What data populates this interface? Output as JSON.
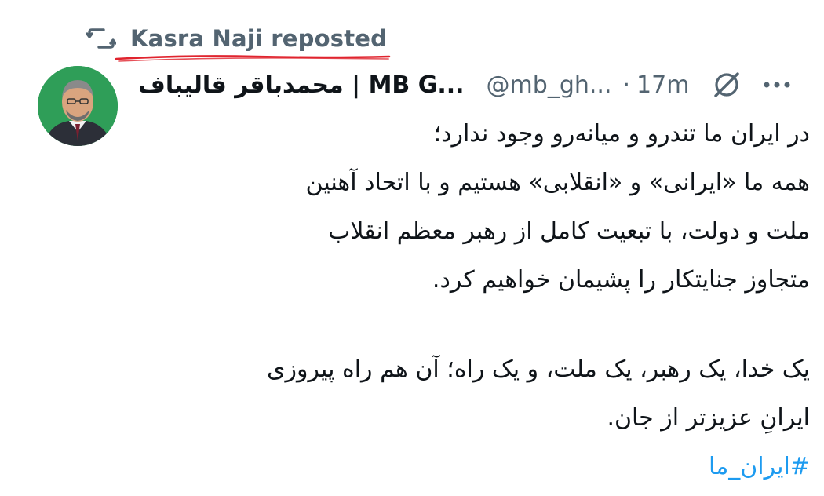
{
  "repost": {
    "label": "Kasra Naji reposted",
    "icon": "repost-icon"
  },
  "author": {
    "name_fa": "محمدباقر قالیباف",
    "name_sep": " | ",
    "name_en": "MB G...",
    "handle": "@mb_gh...",
    "dot": "·",
    "time": "17m",
    "avatar": "avatar"
  },
  "tweet": {
    "lines": [
      "در ایران ما تندرو و میانه‌رو وجود ندارد؛",
      "همه ما «ایرانی» و «انقلابی» هستیم و با اتحاد آهنین",
      "ملت و دولت، با تبعیت کامل از رهبر معظم انقلاب",
      "متجاوز جنایتکار را پشیمان خواهیم کرد.",
      "یک خدا، یک رهبر، یک ملت، و یک راه؛ آن هم راه پیروزی",
      "ایرانِ عزیزتر از جان."
    ],
    "hashtag": "#ایران_ما"
  },
  "colors": {
    "text": "#0f1419",
    "muted": "#536471",
    "link": "#1d9bf0",
    "underline": "#e0242e",
    "avatar_bg": "#2f9e58"
  },
  "icons": [
    "repost-icon",
    "grok-icon",
    "more-icon"
  ]
}
